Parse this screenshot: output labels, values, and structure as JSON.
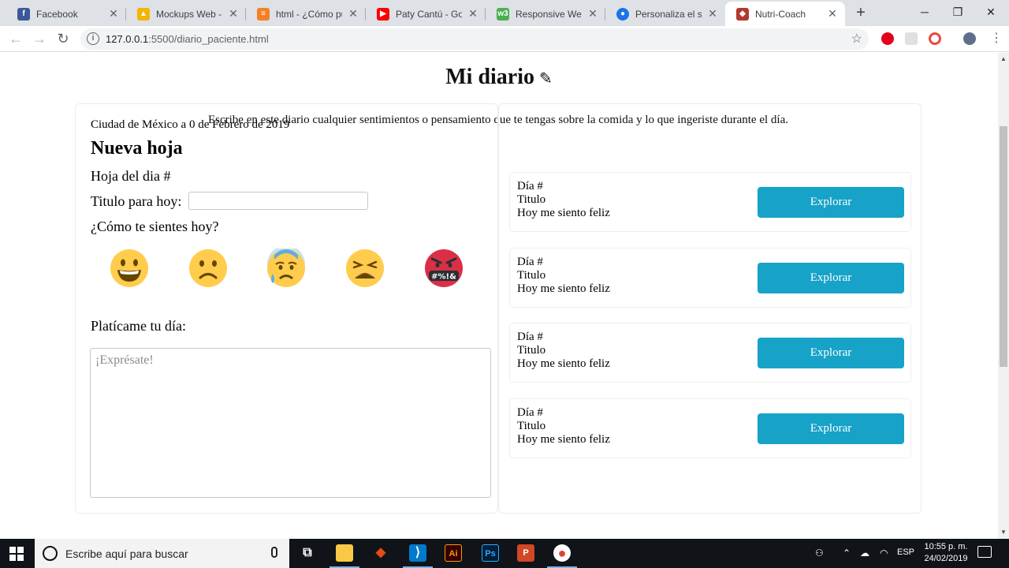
{
  "browser": {
    "tabs": [
      {
        "label": "Facebook",
        "icon": "facebook-icon",
        "color": "#3b5998",
        "glyph": "f"
      },
      {
        "label": "Mockups Web - G",
        "icon": "google-drive-icon",
        "color": "#f4b400",
        "glyph": "▲"
      },
      {
        "label": "html - ¿Cómo pue",
        "icon": "stackoverflow-icon",
        "color": "#f48024",
        "glyph": "≡"
      },
      {
        "label": "Paty Cantú - Goma",
        "icon": "youtube-icon",
        "color": "#ff0000",
        "glyph": "▶"
      },
      {
        "label": "Responsive Web D",
        "icon": "w3schools-icon",
        "color": "#4caf50",
        "glyph": "w3"
      },
      {
        "label": "Personaliza el scro",
        "icon": "chrome-settings-icon",
        "color": "#1a73e8",
        "glyph": "●"
      },
      {
        "label": "Nutri-Coach",
        "icon": "nutri-coach-icon",
        "color": "#b03a2e",
        "glyph": "◆"
      }
    ],
    "new_tab": "+",
    "window_controls": {
      "minimize": "─",
      "maximize": "❐",
      "close": "✕"
    },
    "url_host": "127.0.0.1",
    "url_rest": ":5500/diario_paciente.html",
    "tab_close": "✕"
  },
  "page": {
    "title": "Mi diario",
    "title_icon": "✎",
    "subtitle": "Escribe en este diario cualquier sentimientos o pensamiento que te tengas sobre la comida y lo que ingeriste durante el día.",
    "form": {
      "date": "Ciudad de México a 0 de Febrero de 2019",
      "heading": "Nueva hoja",
      "day_label": "Hoja del dia #",
      "title_label": "Titulo para hoy:",
      "title_value": "",
      "feeling_label": "¿Cómo te sientes hoy?",
      "emojis": [
        "happy-emoji",
        "sad-emoji",
        "anxious-emoji",
        "tired-emoji",
        "angry-emoji"
      ],
      "story_label": "Platícame tu día:",
      "story_placeholder": "¡Exprésate!"
    },
    "entries": [
      {
        "day": "Día #",
        "title": "Titulo",
        "feeling": "Hoy me siento feliz",
        "button": "Explorar"
      },
      {
        "day": "Día #",
        "title": "Titulo",
        "feeling": "Hoy me siento feliz",
        "button": "Explorar"
      },
      {
        "day": "Día #",
        "title": "Titulo",
        "feeling": "Hoy me siento feliz",
        "button": "Explorar"
      },
      {
        "day": "Día #",
        "title": "Titulo",
        "feeling": "Hoy me siento feliz",
        "button": "Explorar"
      }
    ],
    "accent_color": "#17a2c8"
  },
  "taskbar": {
    "search_placeholder": "Escribe aquí para buscar",
    "apps": [
      {
        "name": "task-view-icon",
        "glyph": "⧉"
      },
      {
        "name": "file-explorer-icon",
        "glyph": "▬"
      },
      {
        "name": "git-kraken-icon",
        "glyph": "◆"
      },
      {
        "name": "vscode-icon",
        "glyph": "⟩"
      },
      {
        "name": "illustrator-icon",
        "glyph": "Ai"
      },
      {
        "name": "photoshop-icon",
        "glyph": "Ps"
      },
      {
        "name": "powerpoint-icon",
        "glyph": "P"
      },
      {
        "name": "chrome-icon",
        "glyph": "●"
      }
    ],
    "lang": "ESP",
    "time": "10:55 p. m.",
    "date": "24/02/2019"
  }
}
